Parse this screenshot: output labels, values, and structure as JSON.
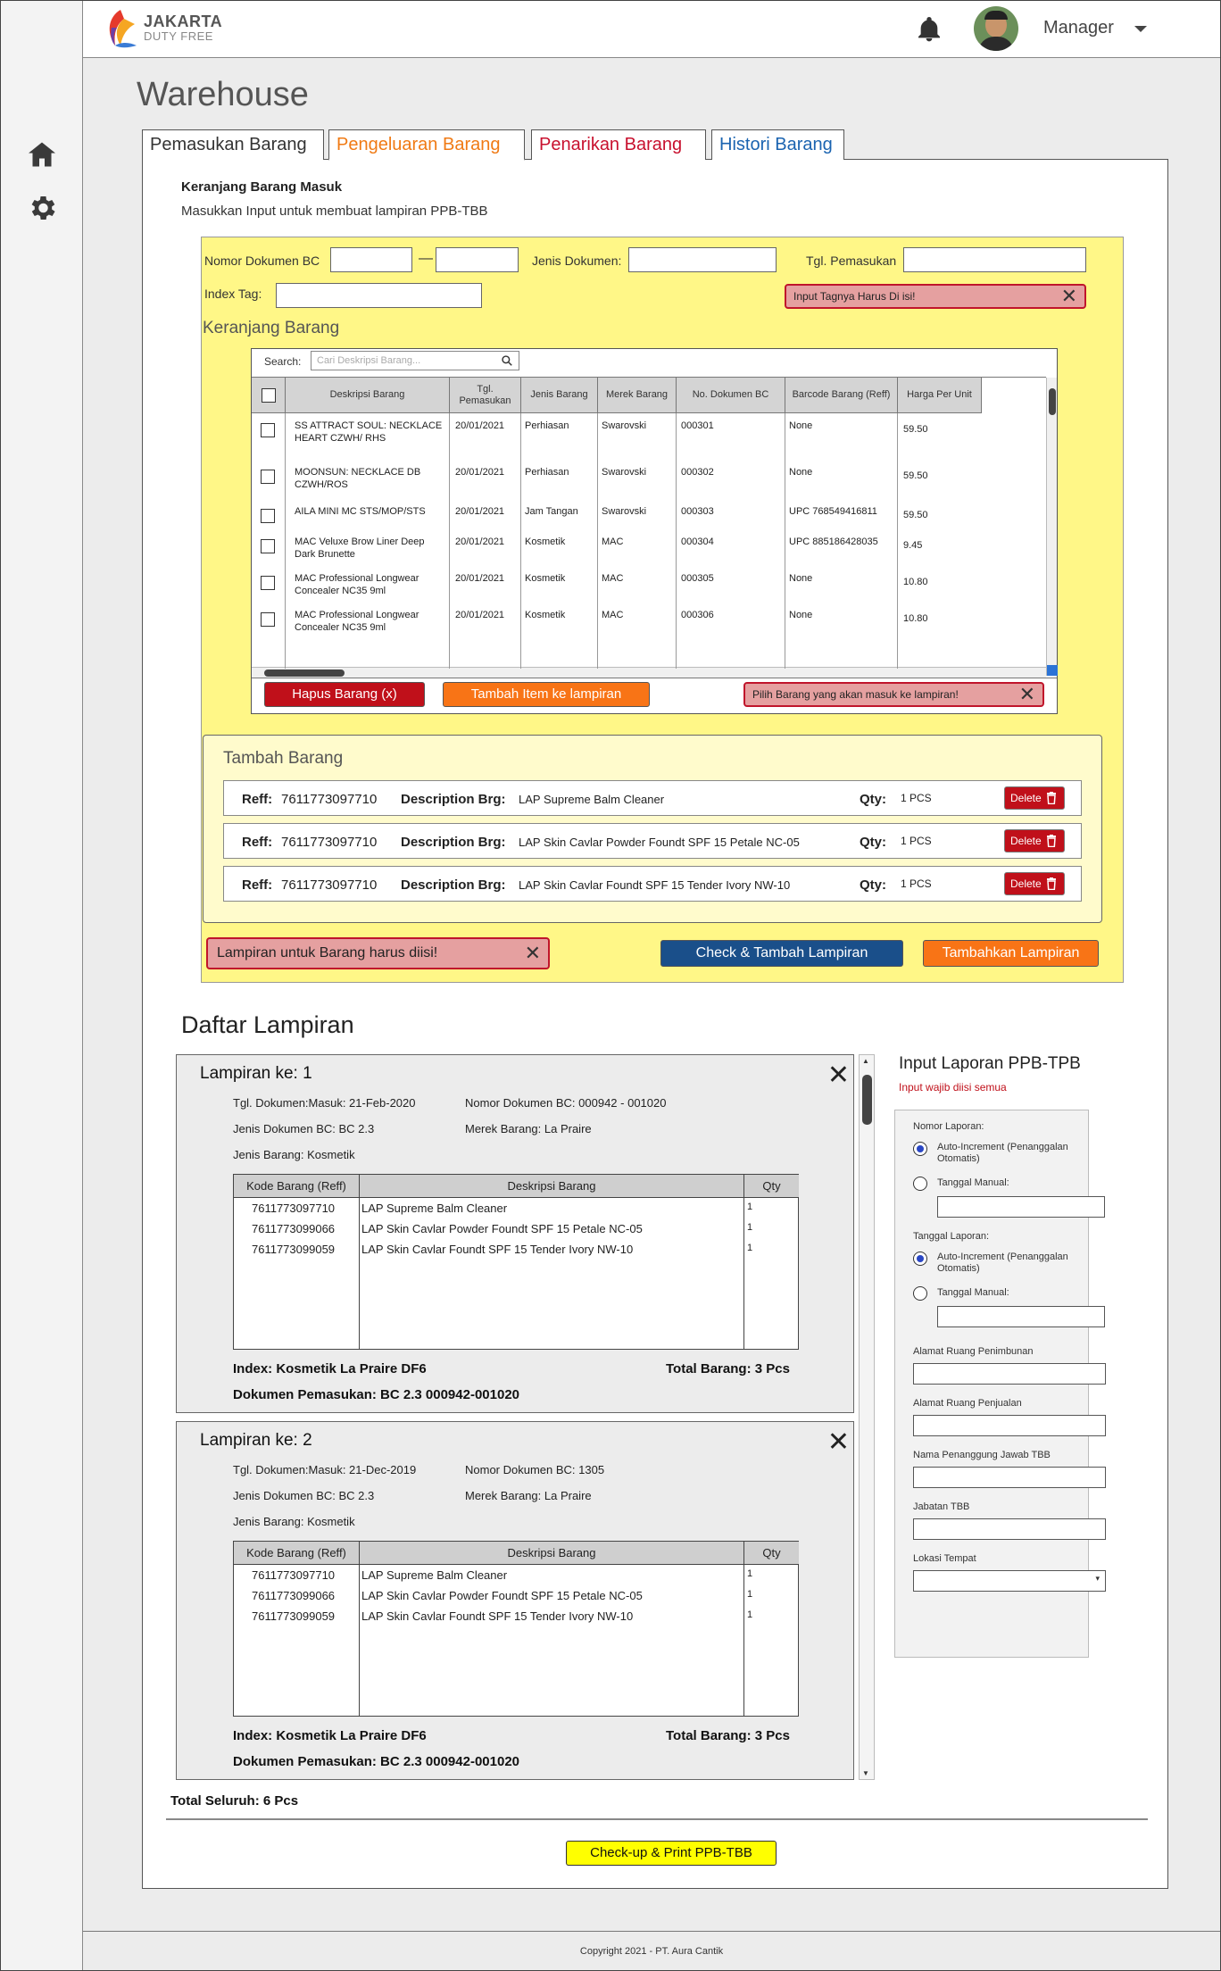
{
  "brand": {
    "name_line1": "JAKARTA",
    "name_line2": "DUTY FREE"
  },
  "user": {
    "name": "Manager"
  },
  "page": {
    "title": "Warehouse"
  },
  "tabs": [
    {
      "label": "Pemasukan Barang",
      "color": "#333333"
    },
    {
      "label": "Pengeluaran Barang",
      "color": "#f07a14"
    },
    {
      "label": "Penarikan Barang",
      "color": "#c8102e"
    },
    {
      "label": "Histori Barang",
      "color": "#1a63b0"
    }
  ],
  "section": {
    "title": "Keranjang  Barang Masuk",
    "subtitle": "Masukkan Input untuk membuat lampiran PPB-TBB"
  },
  "form_top": {
    "nomor_dokumen_label": "Nomor Dokumen BC",
    "dash": "—",
    "jenis_dokumen_label": "Jenis Dokumen:",
    "tgl_pemasukan_label": "Tgl. Pemasukan",
    "index_tag_label": "Index Tag:",
    "index_tag_error": "Input Tagnya Harus Di isi!"
  },
  "keranjang": {
    "title": "Keranjang Barang",
    "search_label": "Search:",
    "search_placeholder": "Cari Deskripsi Barang...",
    "headers": [
      "Deskripsi Barang",
      "Tgl. Pemasukan",
      "Jenis Barang",
      "Merek Barang",
      "No. Dokumen BC",
      "Barcode Barang (Reff)",
      "Harga Per Unit"
    ],
    "rows": [
      {
        "desc": "SS ATTRACT SOUL: NECKLACE HEART CZWH/ RHS",
        "tgl": "20/01/2021",
        "jenis": "Perhiasan",
        "merek": "Swarovski",
        "nodok": "000301",
        "barcode": "None",
        "harga": "59.50"
      },
      {
        "desc": "MOONSUN: NECKLACE DB CZWH/ROS",
        "tgl": "20/01/2021",
        "jenis": "Perhiasan",
        "merek": "Swarovski",
        "nodok": "000302",
        "barcode": "None",
        "harga": "59.50"
      },
      {
        "desc": "AILA MINI MC STS/MOP/STS",
        "tgl": "20/01/2021",
        "jenis": "Jam Tangan",
        "merek": "Swarovski",
        "nodok": "000303",
        "barcode": "UPC 768549416811",
        "harga": "59.50"
      },
      {
        "desc": "MAC Veluxe Brow Liner Deep Dark Brunette",
        "tgl": "20/01/2021",
        "jenis": "Kosmetik",
        "merek": "MAC",
        "nodok": "000304",
        "barcode": "UPC 885186428035",
        "harga": "9.45"
      },
      {
        "desc": "MAC Professional Longwear Concealer NC35 9ml",
        "tgl": "20/01/2021",
        "jenis": "Kosmetik",
        "merek": "MAC",
        "nodok": "000305",
        "barcode": "None",
        "harga": "10.80"
      },
      {
        "desc": "MAC Professional Longwear Concealer NC35 9ml",
        "tgl": "20/01/2021",
        "jenis": "Kosmetik",
        "merek": "MAC",
        "nodok": "000306",
        "barcode": "None",
        "harga": "10.80"
      }
    ],
    "hapus_label": "Hapus Barang (x)",
    "tambah_label": "Tambah Item ke lampiran",
    "error": "Pilih Barang yang akan masuk ke lampiran!"
  },
  "tambah_barang": {
    "title": "Tambah Barang",
    "reff_label": "Reff:",
    "desc_label": "Description Brg:",
    "qty_label": "Qty:",
    "delete_label": "Delete",
    "items": [
      {
        "reff": "7611773097710",
        "desc": "LAP Supreme Balm Cleaner",
        "qty": "1 PCS"
      },
      {
        "reff": "7611773097710",
        "desc": "LAP Skin Cavlar Powder Foundt SPF 15 Petale NC-05",
        "qty": "1 PCS"
      },
      {
        "reff": "7611773097710",
        "desc": "LAP Skin Cavlar Foundt SPF 15 Tender Ivory NW-10",
        "qty": "1 PCS"
      }
    ]
  },
  "actions": {
    "lampiran_error": "Lampiran untuk Barang harus diisi!",
    "check_label": "Check & Tambah Lampiran",
    "tambahkan_label": "Tambahkan Lampiran"
  },
  "daftar": {
    "title": "Daftar Lampiran",
    "col_kode": "Kode Barang (Reff)",
    "col_desk": "Deskripsi Barang",
    "col_qty": "Qty",
    "lampiran": [
      {
        "title": "Lampiran ke: 1",
        "tgl": "Tgl. Dokumen:Masuk: 21-Feb-2020",
        "nomor": "Nomor Dokumen BC: 000942 - 001020",
        "jenis_dok": "Jenis Dokumen BC: BC 2.3",
        "merek": "Merek Barang: La Praire",
        "jenis_barang": "Jenis Barang: Kosmetik",
        "items": [
          {
            "kode": "7611773097710",
            "desk": "LAP Supreme Balm Cleaner",
            "qty": "1"
          },
          {
            "kode": "7611773099066",
            "desk": "LAP Skin Cavlar Powder Foundt SPF 15 Petale NC-05",
            "qty": "1"
          },
          {
            "kode": "7611773099059",
            "desk": "LAP Skin Cavlar Foundt SPF 15 Tender Ivory NW-10",
            "qty": "1"
          }
        ],
        "index": "Index: Kosmetik La Praire DF6",
        "total": "Total Barang: 3 Pcs",
        "dokumen": "Dokumen Pemasukan: BC 2.3 000942-001020"
      },
      {
        "title": "Lampiran ke: 2",
        "tgl": "Tgl. Dokumen:Masuk: 21-Dec-2019",
        "nomor": "Nomor Dokumen BC: 1305",
        "jenis_dok": "Jenis Dokumen BC: BC 2.3",
        "merek": "Merek Barang: La Praire",
        "jenis_barang": "Jenis Barang: Kosmetik",
        "items": [
          {
            "kode": "7611773097710",
            "desk": "LAP Supreme Balm Cleaner",
            "qty": "1"
          },
          {
            "kode": "7611773099066",
            "desk": "LAP Skin Cavlar Powder Foundt SPF 15 Petale NC-05",
            "qty": "1"
          },
          {
            "kode": "7611773099059",
            "desk": "LAP Skin Cavlar Foundt SPF 15 Tender Ivory NW-10",
            "qty": "1"
          }
        ],
        "index": "Index: Kosmetik La Praire DF6",
        "total": "Total Barang: 3 Pcs",
        "dokumen": "Dokumen Pemasukan: BC 2.3 000942-001020"
      }
    ],
    "total_seluruh": "Total Seluruh: 6 Pcs",
    "print_label": "Check-up & Print PPB-TBB"
  },
  "laporan": {
    "title": "Input Laporan PPB-TPB",
    "subtitle": "Input wajib diisi semua",
    "nomor_label": "Nomor Laporan:",
    "auto_label": "Auto-Increment (Penanggalan Otomatis)",
    "manual_label": "Tanggal Manual:",
    "tanggal_label": "Tanggal Laporan:",
    "alamat_penimbunan": "Alamat Ruang Penimbunan",
    "alamat_penjualan": "Alamat Ruang Penjualan",
    "penanggung": "Nama Penanggung Jawab TBB",
    "jabatan": "Jabatan TBB",
    "lokasi": "Lokasi Tempat"
  },
  "footer": {
    "copyright": "Copyright 2021 - PT. Aura Cantik"
  }
}
